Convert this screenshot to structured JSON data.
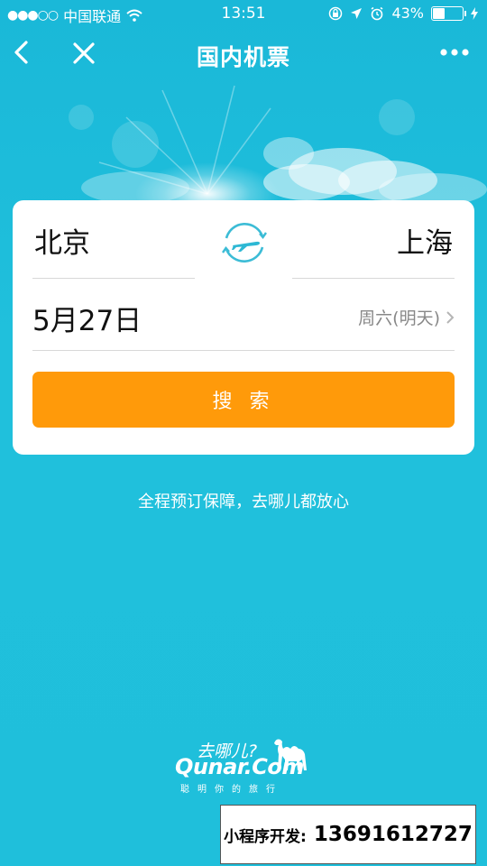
{
  "status": {
    "carrier": "中国联通",
    "time": "13:51",
    "battery": "43%",
    "battery_level": 0.43
  },
  "nav": {
    "title": "国内机票"
  },
  "search": {
    "from_city": "北京",
    "to_city": "上海",
    "date": "5月27日",
    "weekday": "周六(明天)",
    "button_label": "搜 索"
  },
  "tagline": "全程预订保障，去哪儿都放心",
  "logo": {
    "slogan": "去哪儿?",
    "brand": "Qunar.Com",
    "sub": "聪明你的旅行"
  },
  "watermark": {
    "label": "小程序开发:",
    "phone": "13691612727"
  },
  "colors": {
    "background": "#1ec0dc",
    "accent": "#ff9a0a"
  },
  "icons": [
    "back-icon",
    "close-icon",
    "more-icon",
    "swap-plane-icon",
    "chevron-right-icon",
    "wifi-icon",
    "lock-icon",
    "location-icon",
    "alarm-icon",
    "battery-icon",
    "charging-icon",
    "camel-icon"
  ]
}
